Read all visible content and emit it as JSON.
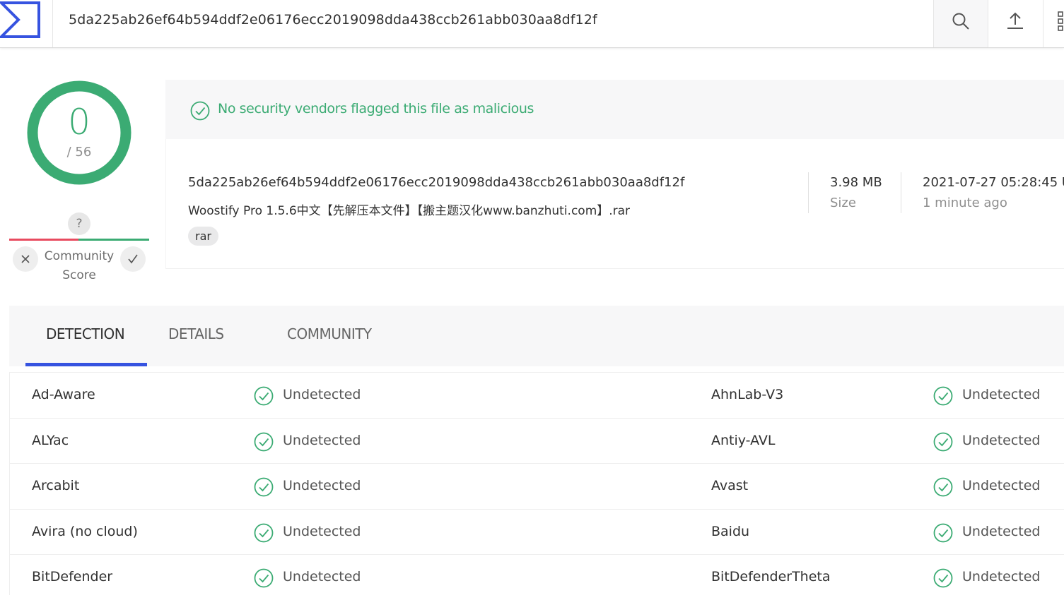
{
  "header": {
    "search_value": "5da225ab26ef64b594ddf2e06176ecc2019098dda438ccb261abb030aa8df12f"
  },
  "score": {
    "detections": "0",
    "total": "/ 56"
  },
  "community": {
    "unknown_symbol": "?",
    "label_line1": "Community",
    "label_line2": "Score"
  },
  "summary": {
    "message": "No security vendors flagged this file as malicious",
    "color": "#3bab73"
  },
  "file": {
    "hash": "5da225ab26ef64b594ddf2e06176ecc2019098dda438ccb261abb030aa8df12f",
    "name": "Woostify Pro 1.5.6中文【先解压本文件】【搬主题汉化www.banzhuti.com】.rar",
    "tag": "rar",
    "size_value": "3.98 MB",
    "size_label": "Size",
    "date_value": "2021-07-27 05:28:45 U",
    "date_label": "1 minute ago"
  },
  "tabs": [
    {
      "label": "DETECTION"
    },
    {
      "label": "DETAILS"
    },
    {
      "label": "COMMUNITY"
    }
  ],
  "accent_color": "#3653e0",
  "detections": [
    {
      "left": {
        "engine": "Ad-Aware",
        "result": "Undetected"
      },
      "right": {
        "engine": "AhnLab-V3",
        "result": "Undetected"
      }
    },
    {
      "left": {
        "engine": "ALYac",
        "result": "Undetected"
      },
      "right": {
        "engine": "Antiy-AVL",
        "result": "Undetected"
      }
    },
    {
      "left": {
        "engine": "Arcabit",
        "result": "Undetected"
      },
      "right": {
        "engine": "Avast",
        "result": "Undetected"
      }
    },
    {
      "left": {
        "engine": "Avira (no cloud)",
        "result": "Undetected"
      },
      "right": {
        "engine": "Baidu",
        "result": "Undetected"
      }
    },
    {
      "left": {
        "engine": "BitDefender",
        "result": "Undetected"
      },
      "right": {
        "engine": "BitDefenderTheta",
        "result": "Undetected"
      }
    }
  ]
}
